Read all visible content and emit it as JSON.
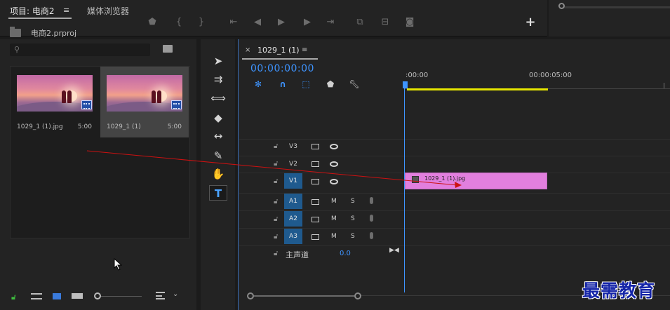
{
  "project_panel": {
    "tab_project": "项目: 电商2",
    "tab_media_browser": "媒体浏览器",
    "project_file": "电商2.prproj",
    "clips": [
      {
        "name": "1029_1 (1).jpg",
        "duration": "5:00"
      },
      {
        "name": "1029_1 (1)",
        "duration": "5:00"
      }
    ]
  },
  "timeline": {
    "sequence_tab": "1029_1 (1)",
    "close": "×",
    "menu": "≡",
    "timecode": "00:00:00:00",
    "ruler": [
      ":00:00",
      "00:00:05:00"
    ],
    "video_tracks": [
      "V3",
      "V2",
      "V1"
    ],
    "audio_tracks": [
      "A1",
      "A2",
      "A3"
    ],
    "mute_label": "M",
    "solo_label": "S",
    "master_track": {
      "label": "主声道",
      "value": "0.0"
    },
    "clip": {
      "label": "1029_1 (1).jpg",
      "color": "#e27fde"
    }
  },
  "top_toolbar": {
    "add": "+"
  },
  "watermark": "最需教育",
  "colors": {
    "accent": "#3e94ff",
    "work_area": "#e6e600",
    "track_active": "#1f5a8e"
  }
}
